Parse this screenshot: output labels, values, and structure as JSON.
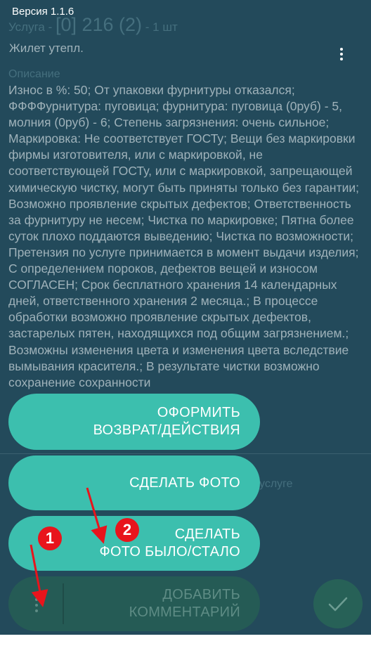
{
  "header": {
    "version": "Версия 1.1.6",
    "service_label": "Услуга - ",
    "service_code": "[0] 216 (2)",
    "service_qty": " - 1 шт",
    "more_icon": "more-vert-icon"
  },
  "item": {
    "name": "Жилет утепл.",
    "description_label": "Описание",
    "description_text": "Износ в %: 50; От упаковки фурнитуры отказался; ФФФФурнитура: пуговица; фурнитура:  пуговица (0руб)  - 5, молния (0руб) - 6; Степень загрязнения: очень сильное; Маркировка: Не соответствует ГОСТу; Вещи без маркировки фирмы изготовителя, или с маркировкой, не соответствующей ГОСТу, или с маркировкой, запрещающей химическую чистку, могут быть приняты только без гарантии; Возможно проявление скрытых дефектов; Ответственность за фурнитуру не несем; Чистка по маркировке; Пятна более суток плохо поддаются выведению; Чистка по возможности; Претензия по услуге принимается в момент выдачи изделия; С определением пороков, дефектов вещей и износом СОГЛАСЕН; Срок бесплатного хранения 14 календарных дней, ответственного хранения 2 месяца.;  В процессе обработки возможно проявление скрытых дефектов, застарелых пятен, находящихся под общим загрязнением.; Возможны изменения цвета и изменения цвета вследствие вымывания красителя.; В результате чистки возможно сохранение сохранности",
    "comment_hint": "услуге"
  },
  "fab_menu": {
    "return_label": "ОФОРМИТЬ\nВОЗВРАТ/ДЕЙСТВИЯ",
    "photo_label": "СДЕЛАТЬ ФОТО",
    "photo_before_after_label": "СДЕЛАТЬ\nФОТО БЫЛО/СТАЛО",
    "comment_label": "ДОБАВИТЬ\nКОММЕНТАРИЙ"
  },
  "annotations": {
    "marker_1": "1",
    "marker_2": "2",
    "color": "#e8141c"
  },
  "icons": {
    "confirm": "check-icon",
    "bottom_more": "more-vert-icon"
  },
  "colors": {
    "background": "#234a5b",
    "accent": "#3cbfae",
    "text_dim": "#9fb2ba"
  }
}
